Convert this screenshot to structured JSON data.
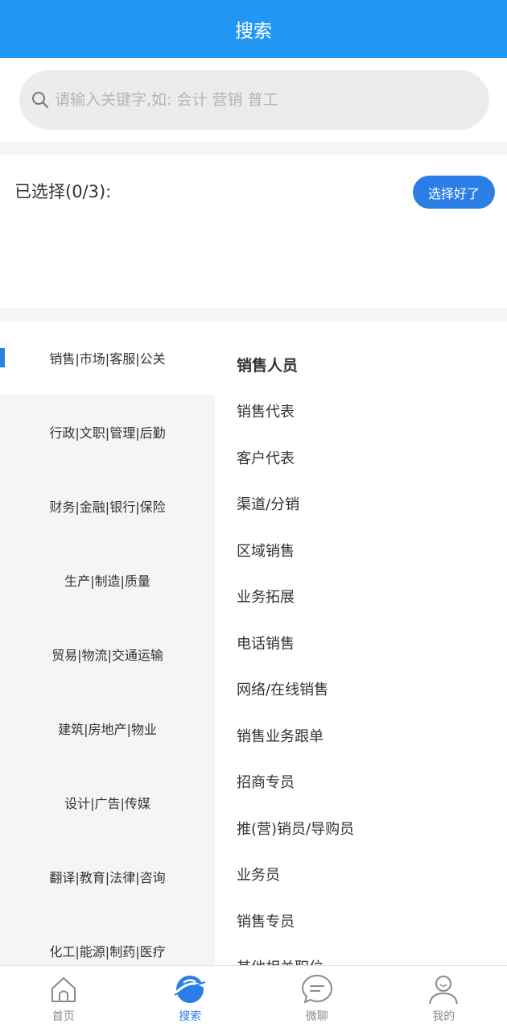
{
  "header": {
    "title": "搜索"
  },
  "search": {
    "placeholder": "请输入关键字,如: 会计 营销 普工"
  },
  "selection": {
    "label": "已选择(0/3):",
    "confirm_label": "选择好了"
  },
  "categories": [
    "销售|市场|客服|公关",
    "行政|文职|管理|后勤",
    "财务|金融|银行|保险",
    "生产|制造|质量",
    "贸易|物流|交通运输",
    "建筑|房地产|物业",
    "设计|广告|传媒",
    "翻译|教育|法律|咨询",
    "化工|能源|制药|医疗"
  ],
  "active_category": "销售|市场|客服|公关",
  "jobs": [
    "销售人员",
    "销售代表",
    "客户代表",
    "渠道/分销",
    "区域销售",
    "业务拓展",
    "电话销售",
    "网络/在线销售",
    "销售业务跟单",
    "招商专员",
    "推(营)销员/导购员",
    "业务员",
    "销售专员",
    "其他相关职位"
  ],
  "tabbar": [
    {
      "label": "首页",
      "icon": "home-icon",
      "active": false
    },
    {
      "label": "搜索",
      "icon": "planet-icon",
      "active": true
    },
    {
      "label": "微聊",
      "icon": "chat-icon",
      "active": false
    },
    {
      "label": "我的",
      "icon": "user-icon",
      "active": false
    }
  ],
  "colors": {
    "header": "#2196f3",
    "accent": "#2a7ee6"
  }
}
